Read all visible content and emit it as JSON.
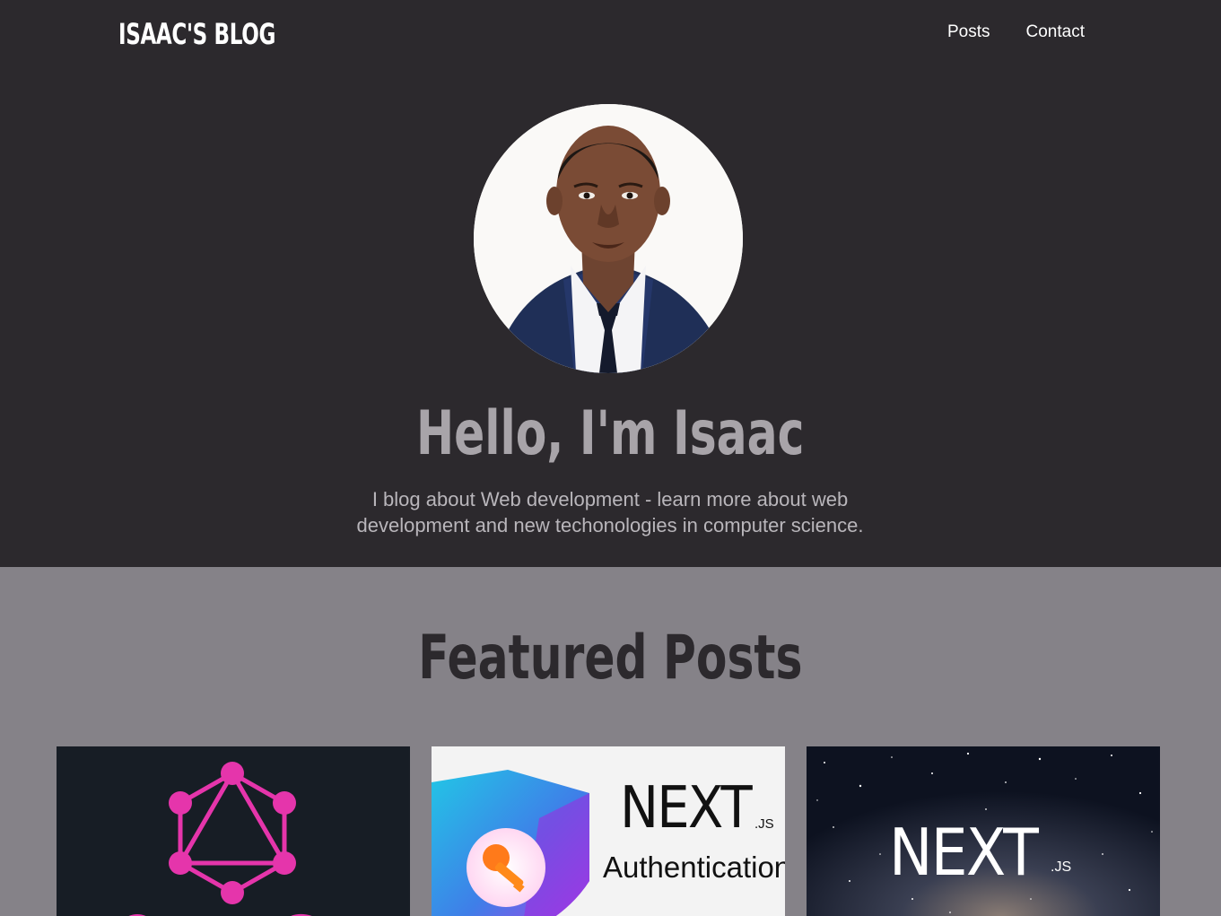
{
  "header": {
    "logo": "ISAAC'S BLOG",
    "nav": [
      {
        "label": "Posts"
      },
      {
        "label": "Contact"
      }
    ]
  },
  "hero": {
    "title": "Hello, I'm Isaac",
    "subtitle": "I blog about Web development - learn more about web development and new techonologies in computer science."
  },
  "featured": {
    "title": "Featured Posts",
    "cards": [
      {
        "image": "graphql-logo",
        "accent": "#e535ab"
      },
      {
        "image": "nextjs-authentication",
        "logo_text": "NEXT",
        "logo_suffix": ".JS",
        "caption": "Authentication"
      },
      {
        "image": "nextjs-starry-sky",
        "logo_text": "NEXT",
        "logo_suffix": ".JS"
      }
    ]
  },
  "colors": {
    "header_bg": "#2c292d",
    "featured_bg": "#858288",
    "title_muted": "#a8a4a9"
  }
}
